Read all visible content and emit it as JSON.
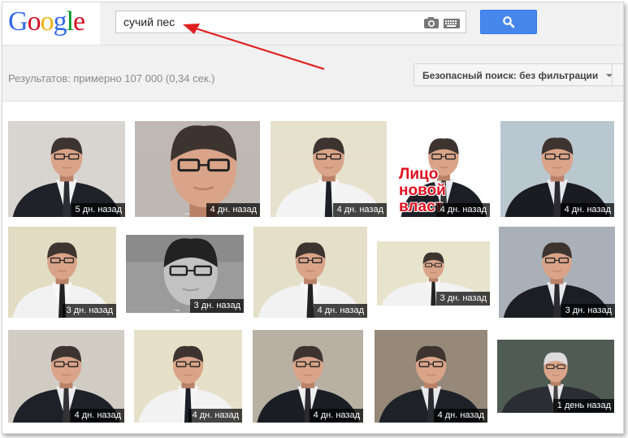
{
  "logo": {
    "letters": [
      {
        "ch": "G",
        "color": "#3369e8"
      },
      {
        "ch": "o",
        "color": "#d50f25"
      },
      {
        "ch": "o",
        "color": "#eeb211"
      },
      {
        "ch": "g",
        "color": "#3369e8"
      },
      {
        "ch": "l",
        "color": "#009925"
      },
      {
        "ch": "e",
        "color": "#d50f25"
      }
    ]
  },
  "search": {
    "query": "сучий пес"
  },
  "results": {
    "stats": "Результатов: примерно 107 000 (0,34 сек.)",
    "safe_search": "Безопасный поиск: без фильтрации"
  },
  "colors": {
    "accent": "#4787ed",
    "annotation_arrow": "#e02020"
  },
  "icons": {
    "search_button": "magnifier-icon",
    "camera": "camera-icon",
    "keyboard": "keyboard-icon"
  },
  "images": [
    {
      "time": "5 дн. назад",
      "bg": "#d8d4cf",
      "suit": "#1f2229",
      "shirt": "#f1f1f2",
      "tie": "#2d2e33",
      "bw": false
    },
    {
      "time": "4 дн. назад",
      "bg": "#bfb8b2",
      "suit": "#272b33",
      "shirt": "#dfe4ea",
      "tie": "#333",
      "bw": false,
      "closeup": true
    },
    {
      "time": "4 дн. назад",
      "bg": "#e6e1cd",
      "suit": "#f3f3f3",
      "shirt": "#f6f6f6",
      "tie": "#1d1f28",
      "bw": false
    },
    {
      "time": "4 дн. назад",
      "bg": "#ffffff",
      "suit": "#1d1f26",
      "shirt": "#e9ecef",
      "tie": "#333",
      "bw": false,
      "overlay": "Лицо\nновой\nвласт"
    },
    {
      "time": "4 дн. назад",
      "bg": "#b9c7cf",
      "suit": "#1a1c22",
      "shirt": "#e7e7ec",
      "tie": "#2a2a30",
      "bw": false
    },
    {
      "time": "3 дн. назад",
      "bg": "#e2dcc2",
      "suit": "#f2f2f2",
      "shirt": "#f7f7f7",
      "tie": "#222",
      "bw": false
    },
    {
      "time": "3 дн. назад",
      "bg": "#9b9b9b",
      "suit": "#ececec",
      "shirt": "#f2f2f2",
      "tie": "#ccc",
      "bw": true,
      "closeup": true
    },
    {
      "time": "4 дн. назад",
      "bg": "#e4dfc9",
      "suit": "#f2f2f2",
      "shirt": "#f6f6f6",
      "tie": "#222",
      "bw": false
    },
    {
      "time": "3 дн. назад",
      "bg": "#e7e3cc",
      "suit": "#f2f2f2",
      "shirt": "#f6f6f6",
      "tie": "#222",
      "bw": false
    },
    {
      "time": "3 дн. назад",
      "bg": "#aab0b7",
      "suit": "#1c1e24",
      "shirt": "#e7e7ec",
      "tie": "#2a2a30",
      "bw": false
    },
    {
      "time": "4 дн. назад",
      "bg": "#d0ccc4",
      "suit": "#1e2128",
      "shirt": "#ececee",
      "tie": "#333",
      "bw": false
    },
    {
      "time": "4 дн. назад",
      "bg": "#e6e0c9",
      "suit": "#f2f2f2",
      "shirt": "#f6f6f6",
      "tie": "#1d1f28",
      "bw": false
    },
    {
      "time": "4 дн. назад",
      "bg": "#b8b0a3",
      "suit": "#1a1d24",
      "shirt": "#eeeeef",
      "tie": "#2a2a30",
      "bw": false
    },
    {
      "time": "4 дн. назад",
      "bg": "#96897a",
      "suit": "#1e2128",
      "shirt": "#e8e8ea",
      "tie": "#2a2a30",
      "bw": false
    },
    {
      "time": "1 день назад",
      "bg": "#4f5b53",
      "suit": "#2a2d33",
      "shirt": "#e8e8ec",
      "tie": "#444",
      "bw": false,
      "grey_hair": true
    }
  ]
}
